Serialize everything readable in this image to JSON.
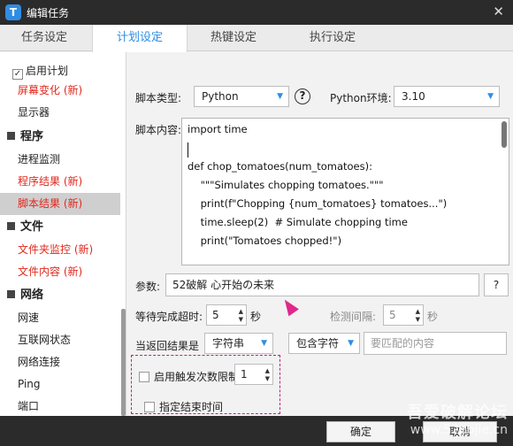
{
  "window": {
    "title": "编辑任务",
    "close": "✕"
  },
  "tabs": [
    {
      "label": "任务设定"
    },
    {
      "label": "计划设定"
    },
    {
      "label": "热键设定"
    },
    {
      "label": "执行设定"
    }
  ],
  "sidebar": {
    "enable_plan": "启用计划",
    "items": [
      {
        "label": "屏幕变化 (新)"
      },
      {
        "label": "显示器"
      },
      {
        "label": "程序"
      },
      {
        "label": "进程监测"
      },
      {
        "label": "程序结果 (新)"
      },
      {
        "label": "脚本结果 (新)"
      },
      {
        "label": "文件"
      },
      {
        "label": "文件夹监控 (新)"
      },
      {
        "label": "文件内容 (新)"
      },
      {
        "label": "网络"
      },
      {
        "label": "网速"
      },
      {
        "label": "互联网状态"
      },
      {
        "label": "网络连接"
      },
      {
        "label": "Ping"
      },
      {
        "label": "端口"
      }
    ]
  },
  "main": {
    "script_type_label": "脚本类型:",
    "script_type_value": "Python",
    "help": "?",
    "py_env_label": "Python环境:",
    "py_env_value": "3.10",
    "script_content_label": "脚本内容:",
    "code": [
      "import time",
      "",
      "def chop_tomatoes(num_tomatoes):",
      "    \"\"\"Simulates chopping tomatoes.\"\"\"",
      "    print(f\"Chopping {num_tomatoes} tomatoes...\")",
      "    time.sleep(2)  # Simulate chopping time",
      "    print(\"Tomatoes chopped!\")"
    ],
    "params_label": "参数:",
    "params_value": "52破解 心开始の未来",
    "params_btn": "?",
    "timeout_label": "等待完成超时:",
    "timeout_value": "5",
    "timeout_unit": "秒",
    "interval_label": "检测间隔:",
    "interval_value": "5",
    "interval_unit": "秒",
    "return_label": "当返回结果是",
    "return_type": "字符串",
    "match_mode": "包含字符",
    "match_placeholder": "要匹配的内容",
    "limit_label": "启用触发次数限制",
    "limit_value": "1",
    "end_time_label": "指定结束时间"
  },
  "footer": {
    "ok": "确定",
    "cancel": "取消"
  },
  "watermark": {
    "line1": "吾爱破解论坛",
    "line2": "www.52pojie.cn"
  }
}
